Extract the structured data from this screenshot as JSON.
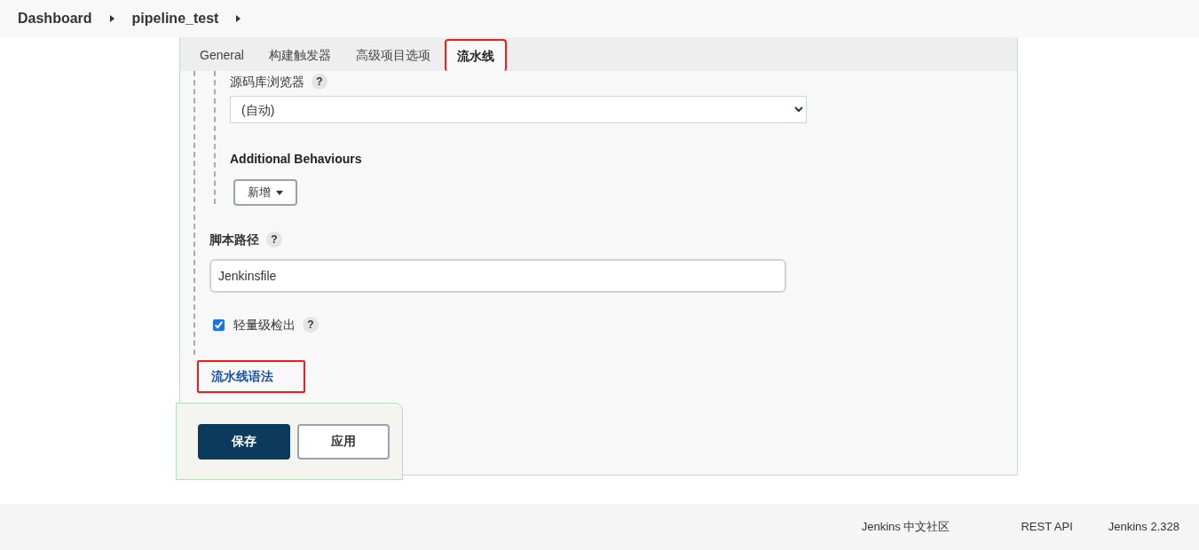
{
  "breadcrumb": [
    {
      "label": "Dashboard"
    },
    {
      "label": "pipeline_test"
    }
  ],
  "tabs": [
    {
      "label": "General",
      "selected": false,
      "highlighted": false
    },
    {
      "label": "构建触发器",
      "selected": false,
      "highlighted": false
    },
    {
      "label": "高级项目选项",
      "selected": false,
      "highlighted": false
    },
    {
      "label": "流水线",
      "selected": true,
      "highlighted": true
    }
  ],
  "repo_browser": {
    "label": "源码库浏览器",
    "help": "?",
    "value": "(自动)"
  },
  "additional_behaviours": {
    "title": "Additional Behaviours",
    "button": "新增"
  },
  "script_path": {
    "label": "脚本路径",
    "help": "?",
    "value": "Jenkinsfile"
  },
  "lightweight_checkout": {
    "label": "轻量级检出",
    "help": "?",
    "checked": true
  },
  "syntax_link": {
    "label": "流水线语法",
    "highlighted": true
  },
  "buttons": [
    {
      "label": "保存",
      "kind": "primary"
    },
    {
      "label": "应用",
      "kind": "secondary"
    }
  ],
  "footer": [
    "Jenkins 中文社区",
    "REST API",
    "Jenkins 2.328"
  ]
}
